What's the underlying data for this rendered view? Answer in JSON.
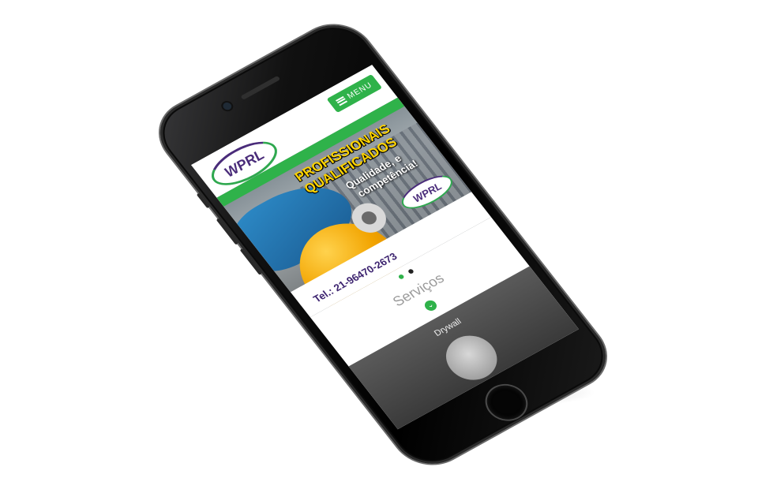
{
  "brand": {
    "logo_text": "WPRL",
    "primary_color": "#2fb24a",
    "secondary_color": "#4a2c7a"
  },
  "header": {
    "menu_label": "MENU",
    "menu_icon": "hamburger-icon"
  },
  "banner": {
    "line1": "PROFISSIONAIS",
    "line2": "QUALIFICADOS",
    "line3": "Qualidade, e",
    "line4": "competência!",
    "logo_text": "WPRL",
    "phone": "Tel.: 21-96470-2673"
  },
  "carousel": {
    "slides": 2,
    "active_index": 0
  },
  "services": {
    "title": "Serviços",
    "badge_icon": "chevron-down-icon",
    "items": [
      {
        "label": "Drywall"
      }
    ]
  }
}
